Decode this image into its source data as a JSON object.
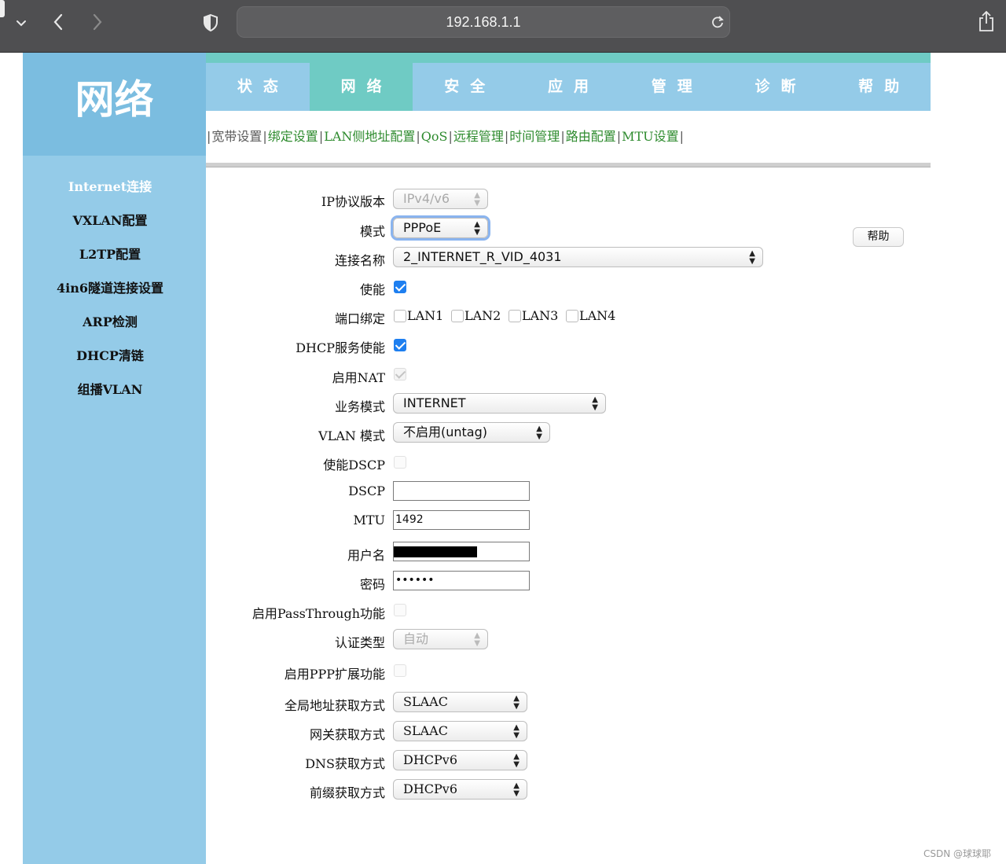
{
  "browser": {
    "url": "192.168.1.1"
  },
  "logo": {
    "text": "网络"
  },
  "nav": {
    "tabs": [
      "状态",
      "网络",
      "安全",
      "应用",
      "管理",
      "诊断",
      "帮助"
    ],
    "active": "网络"
  },
  "subnav": {
    "items": [
      "宽带设置",
      "绑定设置",
      "LAN侧地址配置",
      "QoS",
      "远程管理",
      "时间管理",
      "路由配置",
      "MTU设置"
    ]
  },
  "sidebar": {
    "items": [
      "Internet连接",
      "VXLAN配置",
      "L2TP配置",
      "4in6隧道连接设置",
      "ARP检测",
      "DHCP清链",
      "组播VLAN"
    ],
    "active": "Internet连接"
  },
  "form": {
    "ip_version": {
      "label": "IP协议版本",
      "value": "IPv4/v6"
    },
    "mode": {
      "label": "模式",
      "value": "PPPoE"
    },
    "connection_name": {
      "label": "连接名称",
      "value": "2_INTERNET_R_VID_4031"
    },
    "enable": {
      "label": "使能",
      "checked": true
    },
    "port_binding": {
      "label": "端口绑定",
      "ports": [
        "LAN1",
        "LAN2",
        "LAN3",
        "LAN4"
      ]
    },
    "dhcp_service": {
      "label": "DHCP服务使能",
      "checked": true
    },
    "nat": {
      "label": "启用NAT",
      "checked": true
    },
    "service_mode": {
      "label": "业务模式",
      "value": "INTERNET"
    },
    "vlan_mode": {
      "label": "VLAN 模式",
      "value": "不启用(untag)"
    },
    "dscp_enable": {
      "label": "使能DSCP",
      "checked": false
    },
    "dscp": {
      "label": "DSCP",
      "value": ""
    },
    "mtu": {
      "label": "MTU",
      "value": "1492"
    },
    "username": {
      "label": "用户名"
    },
    "password": {
      "label": "密码",
      "value": "••••••"
    },
    "passthrough": {
      "label": "启用PassThrough功能",
      "checked": false
    },
    "auth_type": {
      "label": "认证类型",
      "value": "自动"
    },
    "ppp_ext": {
      "label": "启用PPP扩展功能",
      "checked": false
    },
    "global_addr": {
      "label": "全局地址获取方式",
      "value": "SLAAC"
    },
    "gateway": {
      "label": "网关获取方式",
      "value": "SLAAC"
    },
    "dns": {
      "label": "DNS获取方式",
      "value": "DHCPv6"
    },
    "prefix": {
      "label": "前缀获取方式",
      "value": "DHCPv6"
    }
  },
  "help_button": {
    "label": "帮助"
  },
  "watermark": "CSDN @球球耶",
  "colors": {
    "sidebar_bg": "#94cbe8",
    "logo_bg": "#7bbde0",
    "nav_active": "#6fcbc4",
    "sublink": "#2e8b2e",
    "checkbox": "#1e7ff0"
  },
  "icons": {
    "back": "chevron-left-icon",
    "forward": "chevron-right-icon",
    "privacy": "shield-icon",
    "reload": "reload-icon",
    "share": "share-icon",
    "tab-menu": "chevron-down-icon"
  }
}
